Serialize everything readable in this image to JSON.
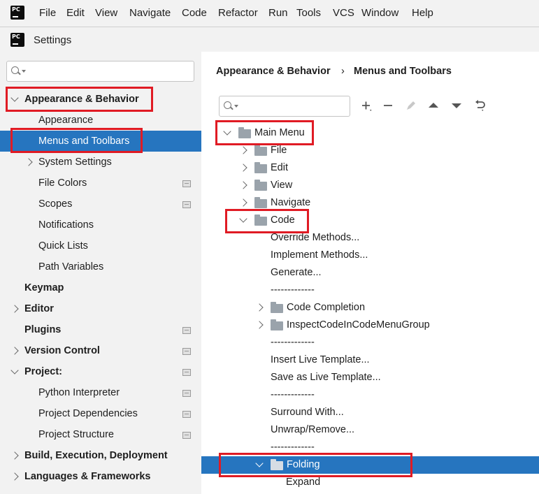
{
  "menubar": {
    "items": [
      "File",
      "Edit",
      "View",
      "Navigate",
      "Code",
      "Refactor",
      "Run",
      "Tools",
      "VCS",
      "Window",
      "Help"
    ],
    "logo_text": "PC"
  },
  "window": {
    "title": "Settings"
  },
  "sidebar": {
    "search_placeholder": "",
    "items": [
      {
        "label": "Appearance & Behavior",
        "bold": true,
        "expand": "down",
        "indent": 0
      },
      {
        "label": "Appearance",
        "indent": 1
      },
      {
        "label": "Menus and Toolbars",
        "indent": 1,
        "selected": true
      },
      {
        "label": "System Settings",
        "indent": 1,
        "expand": "right"
      },
      {
        "label": "File Colors",
        "indent": 1,
        "project": true
      },
      {
        "label": "Scopes",
        "indent": 1,
        "project": true
      },
      {
        "label": "Notifications",
        "indent": 1
      },
      {
        "label": "Quick Lists",
        "indent": 1
      },
      {
        "label": "Path Variables",
        "indent": 1
      },
      {
        "label": "Keymap",
        "bold": true,
        "indent": 0
      },
      {
        "label": "Editor",
        "bold": true,
        "expand": "right",
        "indent": 0
      },
      {
        "label": "Plugins",
        "bold": true,
        "indent": 0,
        "project": true
      },
      {
        "label": "Version Control",
        "bold": true,
        "expand": "right",
        "indent": 0,
        "project": true
      },
      {
        "label": "Project:",
        "bold": true,
        "expand": "down",
        "indent": 0,
        "project": true
      },
      {
        "label": "Python Interpreter",
        "indent": 1,
        "project": true
      },
      {
        "label": "Project Dependencies",
        "indent": 1,
        "project": true
      },
      {
        "label": "Project Structure",
        "indent": 1,
        "project": true
      },
      {
        "label": "Build, Execution, Deployment",
        "bold": true,
        "expand": "right",
        "indent": 0
      },
      {
        "label": "Languages & Frameworks",
        "bold": true,
        "expand": "right",
        "indent": 0
      }
    ]
  },
  "breadcrumb": {
    "parent": "Appearance & Behavior",
    "separator": "›",
    "current": "Menus and Toolbars"
  },
  "toolbar": {
    "icons": [
      "add-icon",
      "remove-icon",
      "edit-icon",
      "move-up-icon",
      "move-down-icon",
      "restore-icon"
    ],
    "search_placeholder": ""
  },
  "tree": [
    {
      "label": "Main Menu",
      "level": 0,
      "folder": true,
      "expand": "down"
    },
    {
      "label": "File",
      "level": 1,
      "folder": true,
      "expand": "right"
    },
    {
      "label": "Edit",
      "level": 1,
      "folder": true,
      "expand": "right"
    },
    {
      "label": "View",
      "level": 1,
      "folder": true,
      "expand": "right"
    },
    {
      "label": "Navigate",
      "level": 1,
      "folder": true,
      "expand": "right"
    },
    {
      "label": "Code",
      "level": 1,
      "folder": true,
      "expand": "down"
    },
    {
      "label": "Override Methods...",
      "level": 2
    },
    {
      "label": "Implement Methods...",
      "level": 2
    },
    {
      "label": "Generate...",
      "level": 2
    },
    {
      "label": "-------------",
      "level": 2
    },
    {
      "label": "Code Completion",
      "level": 2,
      "folder": true,
      "expand": "right"
    },
    {
      "label": "InspectCodeInCodeMenuGroup",
      "level": 2,
      "folder": true,
      "expand": "right"
    },
    {
      "label": "-------------",
      "level": 2
    },
    {
      "label": "Insert Live Template...",
      "level": 2
    },
    {
      "label": "Save as Live Template...",
      "level": 2
    },
    {
      "label": "-------------",
      "level": 2
    },
    {
      "label": "Surround With...",
      "level": 2
    },
    {
      "label": "Unwrap/Remove...",
      "level": 2
    },
    {
      "label": "-------------",
      "level": 2
    },
    {
      "label": "Folding",
      "level": 2,
      "folder": true,
      "expand": "down",
      "selected": true
    },
    {
      "label": "Expand",
      "level": 3
    }
  ],
  "colors": {
    "selection": "#2675bf",
    "highlight": "#e01b24",
    "sidebar_bg": "#f2f2f2"
  }
}
